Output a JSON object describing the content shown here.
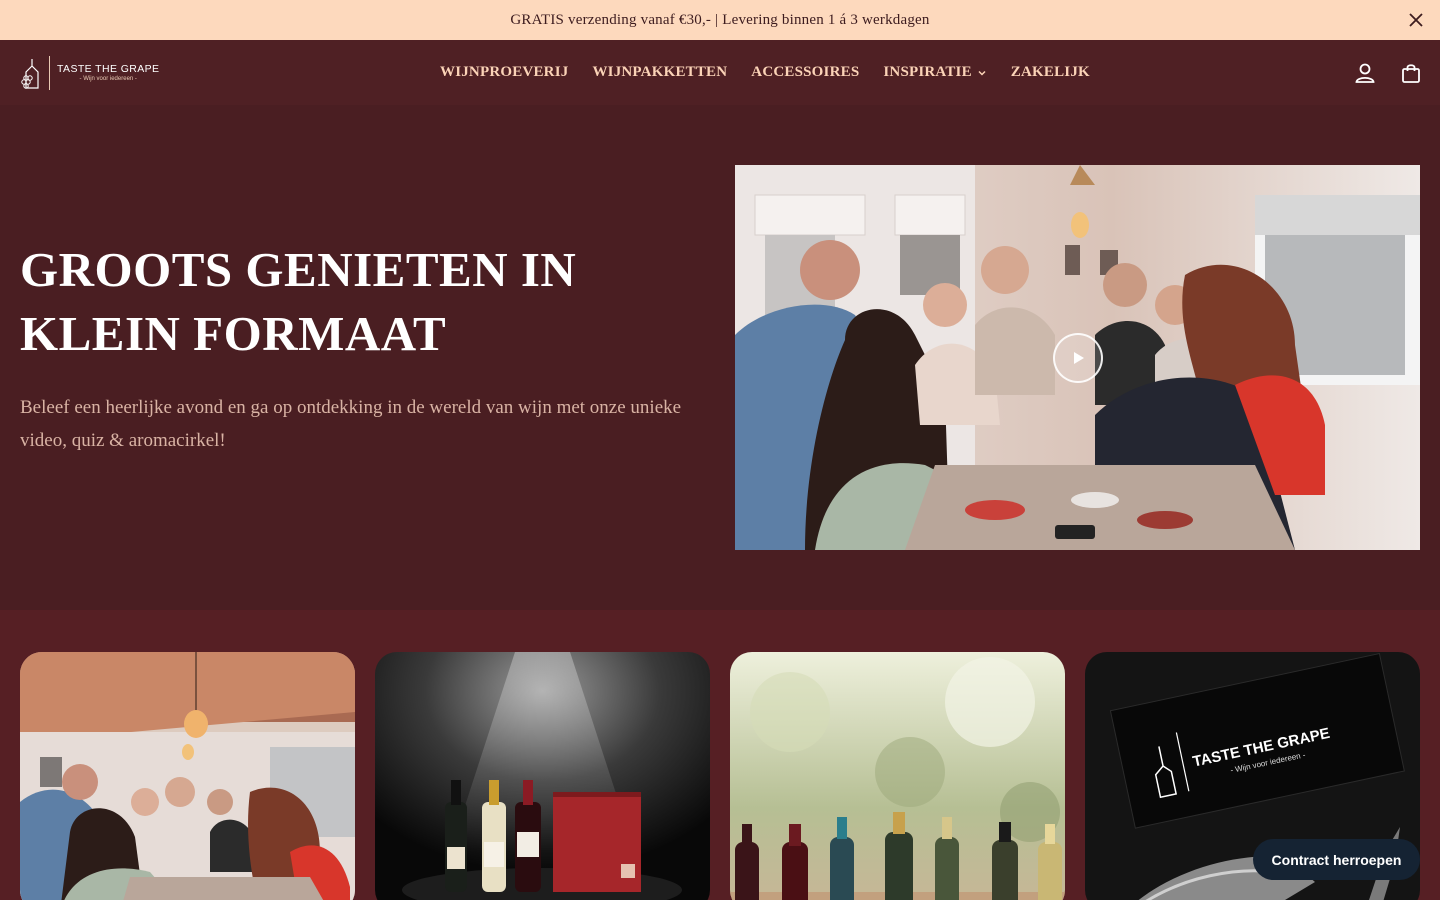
{
  "announcement": {
    "text": "GRATIS verzending vanaf €30,- | Levering binnen 1 á 3 werkdagen",
    "close_icon": "close-icon"
  },
  "header": {
    "logo": {
      "name": "TASTE THE GRAPE",
      "tagline": "- Wijn voor iedereen -"
    },
    "nav": [
      {
        "label": "WIJNPROEVERIJ"
      },
      {
        "label": "WIJNPAKKETTEN"
      },
      {
        "label": "ACCESSOIRES"
      },
      {
        "label": "INSPIRATIE",
        "dropdown": true
      },
      {
        "label": "ZAKELIJK"
      }
    ],
    "icons": [
      "account-icon",
      "cart-icon"
    ]
  },
  "hero": {
    "title": "GROOTS GENIETEN IN KLEIN FORMAAT",
    "subtitle": "Beleef een heerlijke avond en ga op ontdekking in de wereld van wijn met onze unieke video, quiz & aromacirkel!",
    "video_icon": "play-icon"
  },
  "cards": [
    {
      "image": "wine-tasting-party-photo"
    },
    {
      "image": "wine-bottles-gift-box-photo"
    },
    {
      "image": "wine-bottles-row-photo"
    },
    {
      "image": "corkscrew-box-photo",
      "box_text": "TASTE THE GRAPE",
      "box_tag": "- Wijn voor iedereen -"
    }
  ],
  "floating_button": {
    "label": "Contract herroepen"
  },
  "colors": {
    "announcement_bg": "#fdd9bd",
    "header_bg": "#4f2024",
    "page_bg": "#4a1e22",
    "nav_text": "#fbd3b7",
    "button_bg": "#152333"
  }
}
